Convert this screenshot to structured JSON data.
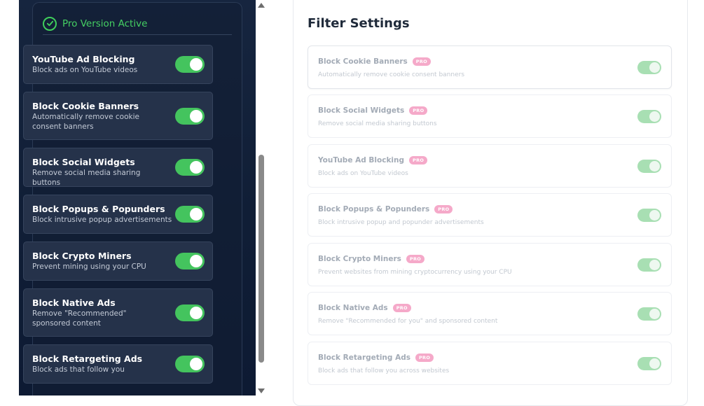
{
  "left": {
    "pro_header": "Pro Version Active",
    "items": [
      {
        "title": "YouTube Ad Blocking",
        "desc": "Block ads on YouTube videos",
        "enabled": true
      },
      {
        "title": "Block Cookie Banners",
        "desc": "Automatically remove cookie consent banners",
        "enabled": true
      },
      {
        "title": "Block Social Widgets",
        "desc": "Remove social media sharing buttons",
        "enabled": true
      },
      {
        "title": "Block Popups & Popunders",
        "desc": "Block intrusive popup advertisements",
        "enabled": true
      },
      {
        "title": "Block Crypto Miners",
        "desc": "Prevent mining using your CPU",
        "enabled": true
      },
      {
        "title": "Block Native Ads",
        "desc": "Remove \"Recommended\" sponsored content",
        "enabled": true
      },
      {
        "title": "Block Retargeting Ads",
        "desc": "Block ads that follow you",
        "enabled": true
      }
    ]
  },
  "right": {
    "title": "Filter Settings",
    "badge": "PRO",
    "items": [
      {
        "title": "Block Cookie Banners",
        "desc": "Automatically remove cookie consent banners",
        "enabled": true
      },
      {
        "title": "Block Social Widgets",
        "desc": "Remove social media sharing buttons",
        "enabled": true
      },
      {
        "title": "YouTube Ad Blocking",
        "desc": "Block ads on YouTube videos",
        "enabled": true
      },
      {
        "title": "Block Popups & Popunders",
        "desc": "Block intrusive popup and popunder advertisements",
        "enabled": true
      },
      {
        "title": "Block Crypto Miners",
        "desc": "Prevent websites from mining cryptocurrency using your CPU",
        "enabled": true
      },
      {
        "title": "Block Native Ads",
        "desc": "Remove \"Recommended for you\" and sponsored content",
        "enabled": true
      },
      {
        "title": "Block Retargeting Ads",
        "desc": "Block ads that follow you across websites",
        "enabled": true
      }
    ]
  },
  "colors": {
    "accent_green": "#44c45e",
    "pro_badge_pink": "#f5a9c9",
    "dark_bg": "#101e36"
  }
}
